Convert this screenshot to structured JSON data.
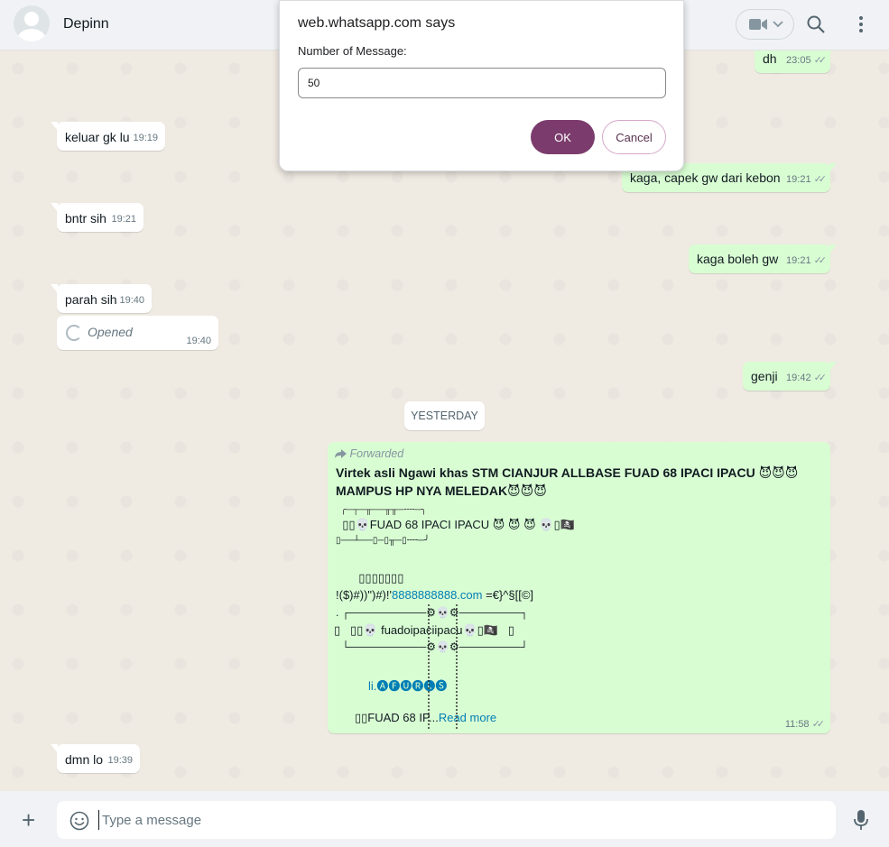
{
  "header": {
    "contact_name": "Depinn"
  },
  "dialog": {
    "title": "web.whatsapp.com says",
    "label": "Number of Message:",
    "input_value": "50",
    "ok_label": "OK",
    "cancel_label": "Cancel"
  },
  "messages": [
    {
      "dir": "out",
      "text": "dh",
      "time": "23:05"
    },
    {
      "dir": "in",
      "text": "keluar gk lu",
      "time": "19:19"
    },
    {
      "dir": "out",
      "text": "kaga, capek gw dari kebon",
      "time": "19:21"
    },
    {
      "dir": "in",
      "text": "bntr sih",
      "time": "19:21"
    },
    {
      "dir": "out",
      "text": "kaga boleh gw",
      "time": "19:21"
    },
    {
      "dir": "in",
      "text": "parah sih",
      "time": "19:40"
    },
    {
      "dir": "in",
      "text": "Opened",
      "time": "19:40"
    },
    {
      "dir": "out",
      "text": "genji",
      "time": "19:42"
    },
    {
      "dir": "in",
      "text": "dmn lo",
      "time": "19:39"
    }
  ],
  "date_chip": "YESTERDAY",
  "forwarded": {
    "label": "Forwarded",
    "title": "Virtek asli Ngawi khas  STM CIANJUR ALLBASE FUAD 68 IPACI IPACU 😈😈😈 MAMPUS HP NYA MELEDAK😈😈😈",
    "line1": "  ╭─┬─╥──╥╥─╌╌─╮",
    "line2": "  ▯▯💀FUAD 68 IPACI IPACU 😈 😈 😈 💀▯🏴‍☠️",
    "line3": "▯──┴──▯─▯╥─▯╌╌─╯",
    "line4": "       ▯▯▯▯▯▯▯",
    "line5_pre": "!($)#))\")#)!'",
    "line5_link": "8888888888.com",
    "line5_post": "  =€}^§[[©]",
    "line6": ". ┌──────────⚙💀⚙────────┐",
    "line7": "▯   ▯▯💀 fuadoipaciipacu💀▯🏴‍☠️   ▯",
    "line8": "  └──────────⚙💀⚙────────┘",
    "line9": "li.🅐🅕🅤🅡🅛🅢",
    "line10_pre": "▯▯FUAD 68 IP...",
    "line10_link": "Read more",
    "time": "11:58"
  },
  "composer": {
    "placeholder": "Type a message"
  },
  "icons": [
    "video-call-icon",
    "chevron-down-icon",
    "search-icon",
    "menu-icon",
    "plus-icon",
    "emoji-icon",
    "mic-icon",
    "forward-icon",
    "double-check-icon"
  ]
}
